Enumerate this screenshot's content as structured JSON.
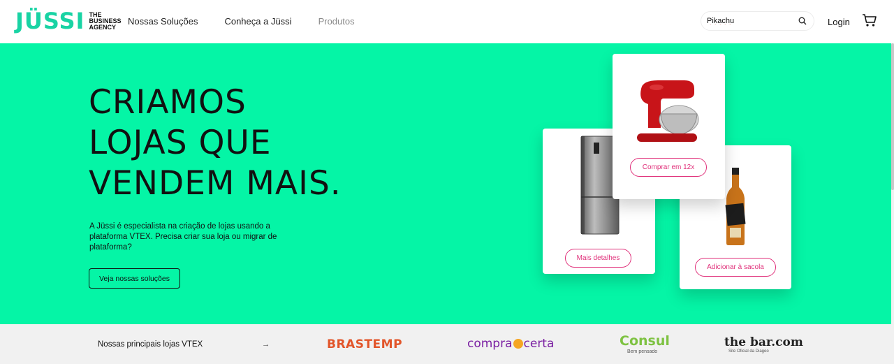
{
  "header": {
    "logo_mark": "JÜSSI",
    "logo_tag": [
      "THE",
      "BUSINESS",
      "AGENCY"
    ],
    "nav": [
      "Nossas Soluções",
      "Conheça a Jüssi",
      "Produtos"
    ],
    "search_value": "Pikachu",
    "search_icon": "search-icon",
    "login_label": "Login",
    "cart_icon": "cart-icon"
  },
  "hero": {
    "headline": [
      "CRIAMOS",
      "LOJAS QUE",
      "VENDEM MAIS."
    ],
    "description": "A Jüssi é especialista na criação de lojas usando a plataforma VTEX. Precisa criar sua loja ou migrar de plataforma?",
    "cta_label": "Veja nossas soluções",
    "background_color": "#05f5a6",
    "accent_color": "#e0307a",
    "cards": {
      "mixer": {
        "image": "stand-mixer-image",
        "button": "Comprar em 12x"
      },
      "fridge": {
        "image": "refrigerator-image",
        "button": "Mais detalhes"
      },
      "whisky": {
        "image": "whisky-bottle-image",
        "button": "Adicionar à sacola"
      }
    }
  },
  "brands": {
    "title": "Nossas principais lojas VTEX",
    "arrow": "→",
    "brastemp": "BRASTEMP",
    "compracerta_left": "compra",
    "compracerta_right": "certa",
    "consul": "Consul",
    "consul_sub": "Bem pensado",
    "thebar": "the bar.com",
    "thebar_sub": "Site Oficial da Diageo"
  }
}
